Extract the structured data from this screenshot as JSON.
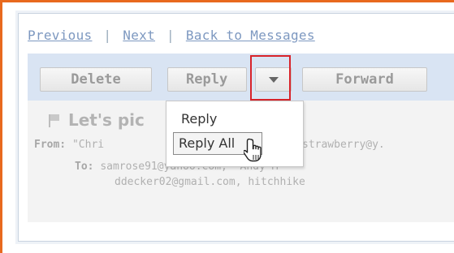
{
  "nav": {
    "previous": "Previous",
    "separator": "|",
    "next": "Next",
    "back": "Back to Messages"
  },
  "toolbar": {
    "delete_label": "Delete",
    "reply_label": "Reply",
    "forward_label": "Forward"
  },
  "dropdown": {
    "items": [
      "Reply",
      "Reply All"
    ],
    "hovered": "Reply All"
  },
  "message": {
    "subject": "Let's pic",
    "from_label": "From:",
    "from_start": "\"Chri",
    "from_end": "strawberry@y.",
    "to_label": "To:",
    "to_line1": "samrose91@yahoo.com, \"Andy M",
    "to_line2": "ddecker02@gmail.com, hitchhike"
  },
  "colors": {
    "frame": "#e8691e",
    "toolbar_bg": "#d9e4f3",
    "highlight": "#d8232a",
    "link": "#7d98c0"
  },
  "icons": [
    "flag-icon",
    "chevron-down-icon",
    "hand-pointer-icon"
  ]
}
